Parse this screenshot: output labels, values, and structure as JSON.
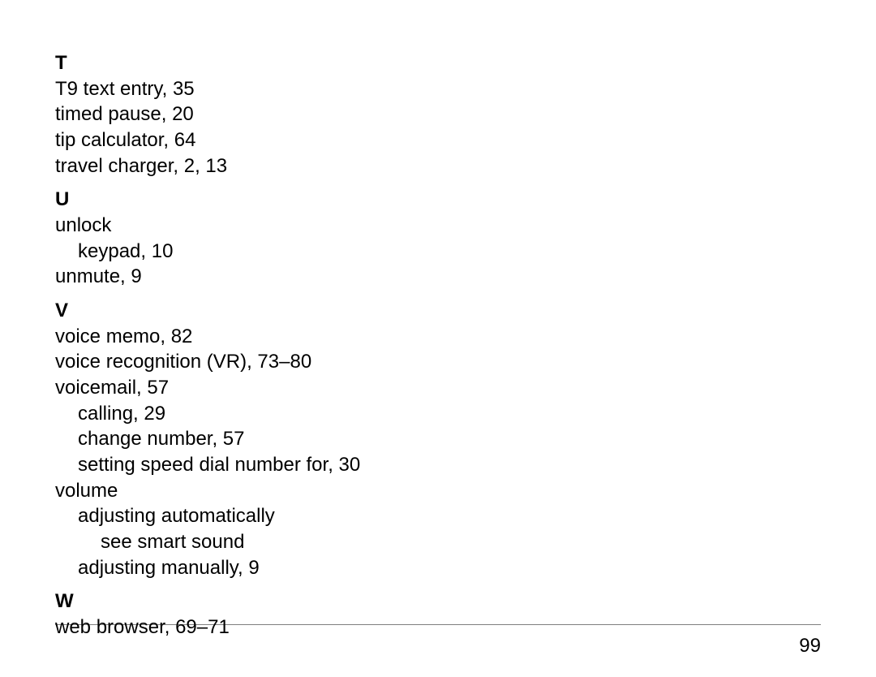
{
  "page_number": "99",
  "index": {
    "sections": [
      {
        "letter": "T",
        "entries": [
          {
            "text": "T9 text entry, 35",
            "indent": 0
          },
          {
            "text": "timed pause, 20",
            "indent": 0
          },
          {
            "text": "tip calculator, 64",
            "indent": 0
          },
          {
            "text": "travel charger, 2, 13",
            "indent": 0
          }
        ]
      },
      {
        "letter": "U",
        "entries": [
          {
            "text": "unlock",
            "indent": 0
          },
          {
            "text": "keypad, 10",
            "indent": 1
          },
          {
            "text": "unmute, 9",
            "indent": 0
          }
        ]
      },
      {
        "letter": "V",
        "entries": [
          {
            "text": "voice memo, 82",
            "indent": 0
          },
          {
            "text": "voice recognition (VR), 73–80",
            "indent": 0
          },
          {
            "text": "voicemail, 57",
            "indent": 0
          },
          {
            "text": "calling, 29",
            "indent": 1
          },
          {
            "text": "change number, 57",
            "indent": 1
          },
          {
            "text": "setting speed dial number for, 30",
            "indent": 1
          },
          {
            "text": "volume",
            "indent": 0
          },
          {
            "text": "adjusting automatically",
            "indent": 1
          },
          {
            "text": "see smart sound",
            "indent": 2
          },
          {
            "text": "adjusting manually, 9",
            "indent": 1
          }
        ]
      },
      {
        "letter": "W",
        "entries": [
          {
            "text": "web browser, 69–71",
            "indent": 0
          }
        ]
      }
    ]
  }
}
